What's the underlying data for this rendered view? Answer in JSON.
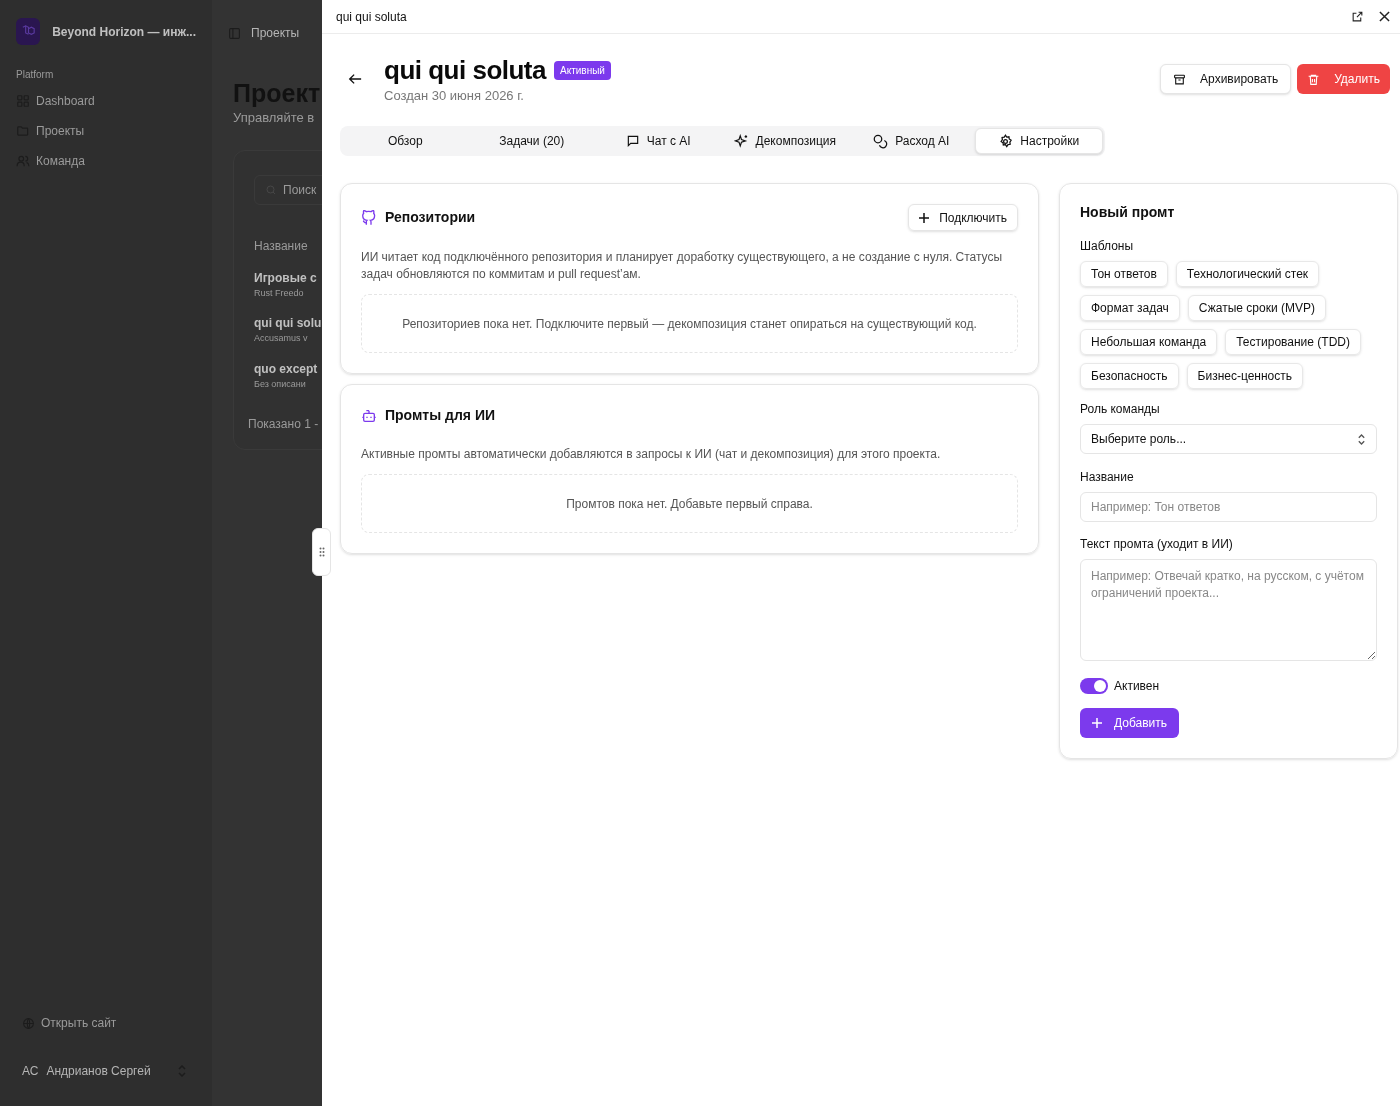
{
  "background_app": {
    "workspace_name": "Beyond Horizon — инж...",
    "sidebar_group": "Platform",
    "nav_items": [
      {
        "label": "Dashboard"
      },
      {
        "label": "Проекты"
      },
      {
        "label": "Команда"
      }
    ],
    "open_site": "Открыть сайт",
    "user": {
      "initials": "АС",
      "name": "Андрианов Сергей"
    },
    "breadcrumb": "Проекты",
    "page_title": "Проект",
    "page_subtitle": "Управляйте в",
    "search_placeholder": "Поиск",
    "column_1": "Название",
    "rows": [
      {
        "title": "Игровые с",
        "subtitle": "Rust Freedo"
      },
      {
        "title": "qui qui solu",
        "subtitle": "Accusamus v"
      },
      {
        "title": "quo except",
        "subtitle": "Без описани"
      }
    ],
    "pagination": "Показано 1 -"
  },
  "sheet": {
    "title": "qui qui soluta",
    "project_name": "qui qui soluta",
    "status_badge": "Активный",
    "created": "Создан 30 июня 2026 г.",
    "actions": [
      {
        "label": "Архивировать",
        "kind": "archive"
      },
      {
        "label": "Удалить",
        "kind": "delete"
      }
    ],
    "tabs": [
      {
        "label": "Обзор",
        "selected": false
      },
      {
        "label": "Задачи (20)",
        "selected": false
      },
      {
        "label": "Чат с AI",
        "selected": false
      },
      {
        "label": "Декомпозиция",
        "selected": false
      },
      {
        "label": "Расход AI",
        "selected": false
      },
      {
        "label": "Настройки",
        "selected": true
      }
    ],
    "repositories": {
      "title": "Репозитории",
      "connect_button": "Подключить",
      "description": "ИИ читает код подключённого репозитория и планирует доработку существующего, а не создание с нуля. Статусы задач обновляются по коммитам и pull request’ам.",
      "empty": "Репозиториев пока нет. Подключите первый — декомпозиция станет опираться на существующий код."
    },
    "prompts": {
      "title": "Промты для ИИ",
      "description": "Активные промты автоматически добавляются в запросы к ИИ (чат и декомпозиция) для этого проекта.",
      "empty": "Промтов пока нет. Добавьте первый справа."
    },
    "new_prompt": {
      "title": "Новый промт",
      "templates_label": "Шаблоны",
      "templates": [
        "Тон ответов",
        "Технологический стек",
        "Формат задач",
        "Сжатые сроки (MVP)",
        "Небольшая команда",
        "Тестирование (TDD)",
        "Безопасность",
        "Бизнес-ценность"
      ],
      "role_label": "Роль команды",
      "role_placeholder": "Выберите роль...",
      "name_label": "Название",
      "name_placeholder": "Например: Тон ответов",
      "text_label": "Текст промта (уходит в ИИ)",
      "text_placeholder": "Например: Отвечай кратко, на русском, с учётом ограничений проекта...",
      "active_toggle": {
        "label": "Активен",
        "on": true
      },
      "add_button": "Добавить"
    }
  }
}
